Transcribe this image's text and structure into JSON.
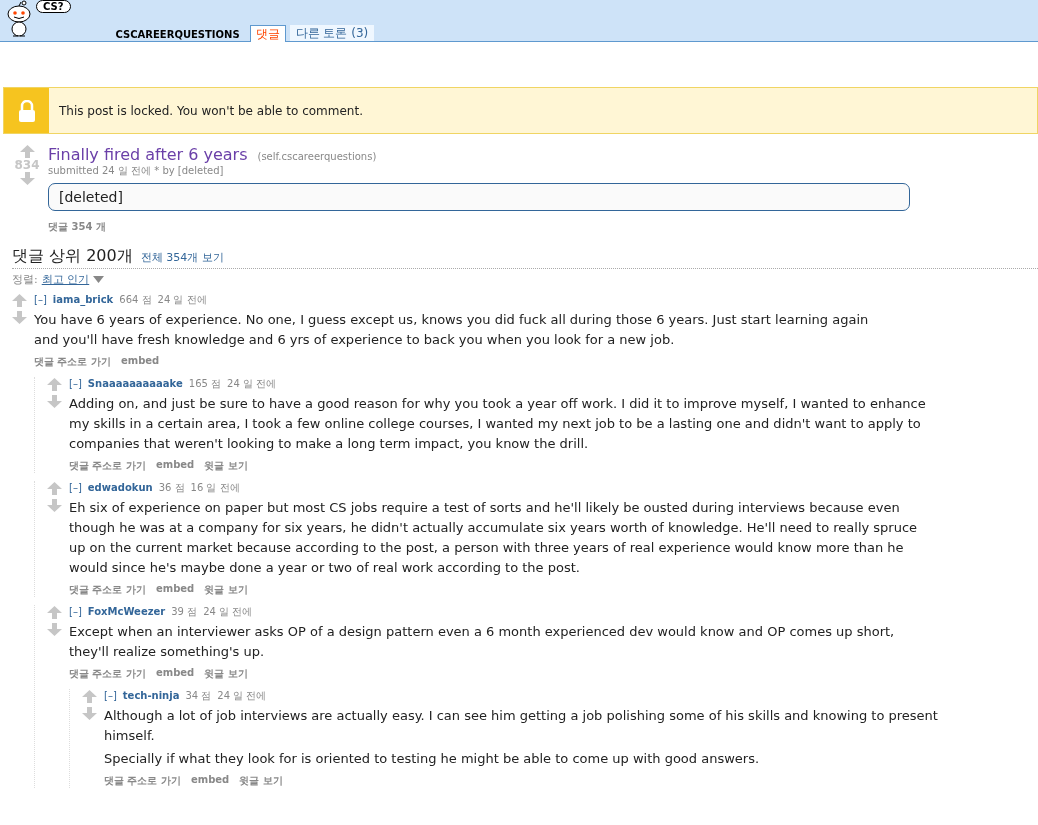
{
  "header": {
    "logo_text": "CS?",
    "subreddit": "CSCAREERQUESTIONS",
    "tabs": [
      {
        "label": "댓글",
        "selected": true
      },
      {
        "label": "다른 토론 (3)",
        "selected": false
      }
    ]
  },
  "notice": {
    "text": "This post is locked. You won't be able to comment."
  },
  "post": {
    "score": "834",
    "title": "Finally fired after 6 years",
    "domain": "(self.cscareerquestions)",
    "tagline": "submitted 24 일 전에 * by [deleted]",
    "body": "[deleted]",
    "comments_link": "댓글 354 개"
  },
  "comments_header": {
    "title": "댓글 상위 200개",
    "view_all": "전체 354개 보기",
    "sort_label": "정렬:",
    "sort_value": "최고 인기"
  },
  "comments": [
    {
      "toggle": "[–]",
      "author": "iama_brick",
      "score": "664 점",
      "age": "24 일 전에",
      "paragraphs": [
        "You have 6 years of experience. No one, I guess except us, knows you did fuck all during those 6 years. Just start learning again and you'll have fresh knowledge and 6 yrs of experience to back you when you look for a new job."
      ],
      "links": [
        "댓글 주소로 가기",
        "embed"
      ],
      "children": [
        {
          "toggle": "[–]",
          "author": "Snaaaaaaaaaake",
          "score": "165 점",
          "age": "24 일 전에",
          "paragraphs": [
            "Adding on, and just be sure to have a good reason for why you took a year off work. I did it to improve myself, I wanted to enhance my skills in a certain area, I took a few online college courses, I wanted my next job to be a lasting one and didn't want to apply to companies that weren't looking to make a long term impact, you know the drill."
          ],
          "links": [
            "댓글 주소로 가기",
            "embed",
            "윗글 보기"
          ]
        },
        {
          "toggle": "[–]",
          "author": "edwadokun",
          "score": "36 점",
          "age": "16 일 전에",
          "paragraphs": [
            "Eh six of experience on paper but most CS jobs require a test of sorts and he'll likely be ousted during interviews because even though he was at a company for six years, he didn't actually accumulate six years worth of knowledge. He'll need to really spruce up on the current market because according to the post, a person with three years of real experience would know more than he would since he's maybe done a year or two of real work according to the post."
          ],
          "links": [
            "댓글 주소로 가기",
            "embed",
            "윗글 보기"
          ]
        },
        {
          "toggle": "[–]",
          "author": "FoxMcWeezer",
          "score": "39 점",
          "age": "24 일 전에",
          "paragraphs": [
            "Except when an interviewer asks OP of a design pattern even a 6 month experienced dev would know and OP comes up short, they'll realize something's up."
          ],
          "links": [
            "댓글 주소로 가기",
            "embed",
            "윗글 보기"
          ],
          "children": [
            {
              "toggle": "[–]",
              "author": "tech-ninja",
              "score": "34 점",
              "age": "24 일 전에",
              "paragraphs": [
                "Although a lot of job interviews are actually easy. I can see him getting a job polishing some of his skills and knowing to present himself.",
                "Specially if what they look for is oriented to testing he might be able to come up with good answers."
              ],
              "links": [
                "댓글 주소로 가기",
                "embed",
                "윗글 보기"
              ]
            }
          ]
        }
      ]
    }
  ]
}
